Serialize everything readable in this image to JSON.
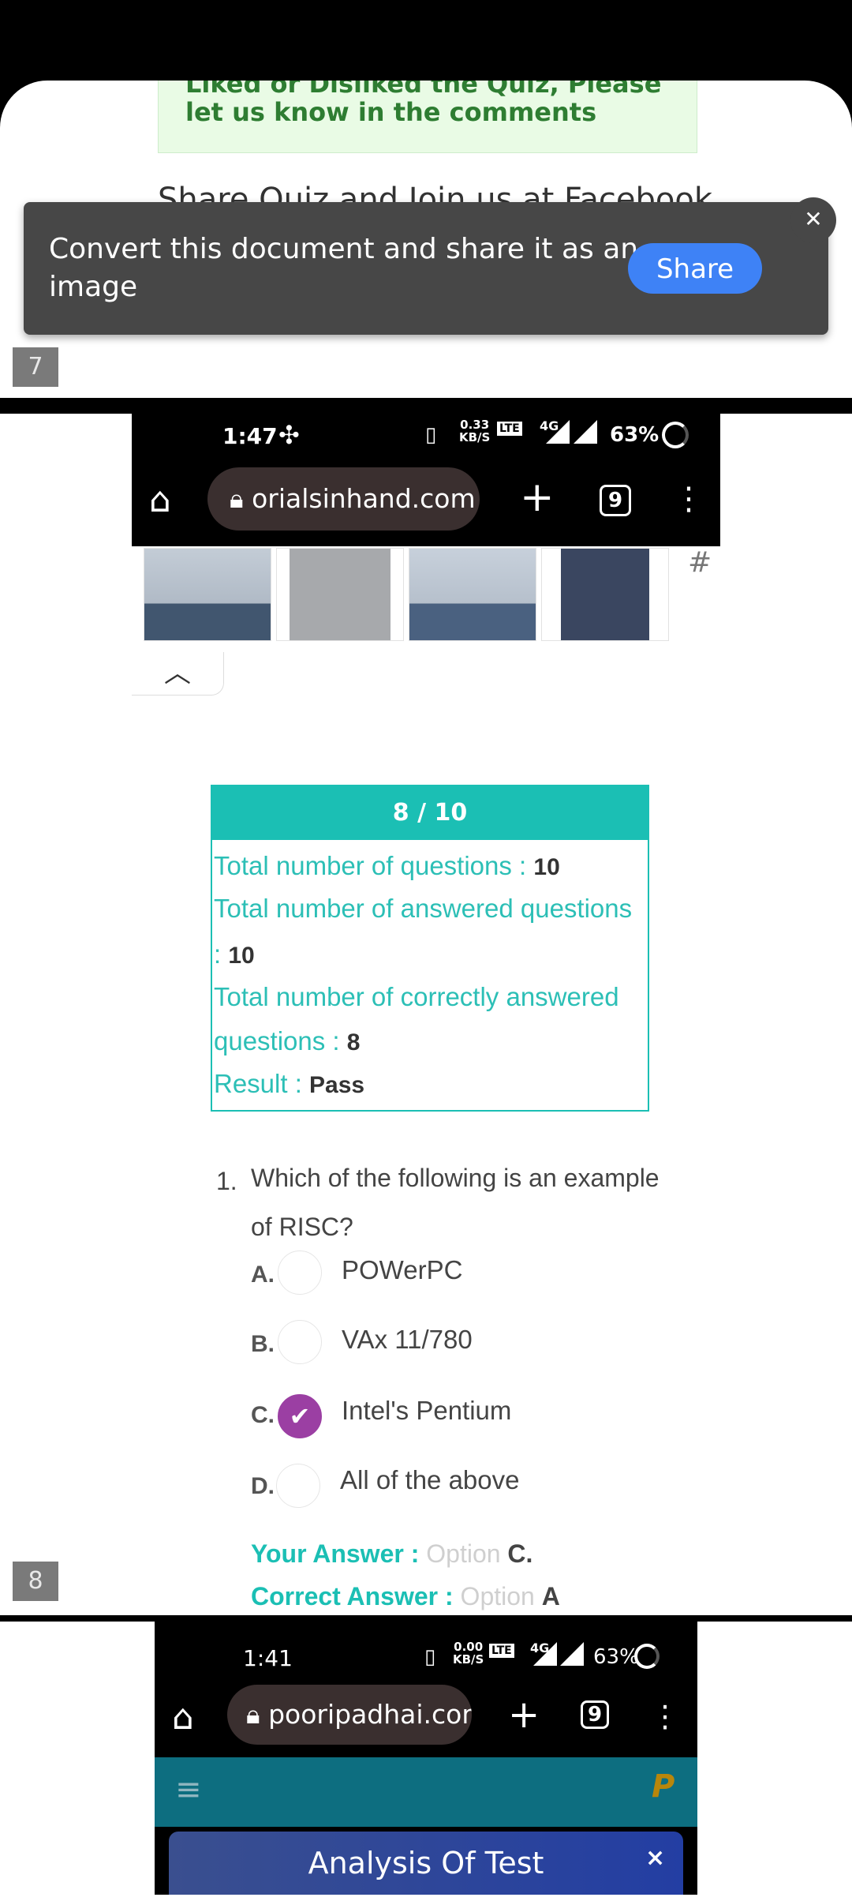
{
  "top_document": {
    "comment_text": "Liked or Disliked the Quiz, Please let us know in the comments",
    "share_heading": "Share Quiz and Join us at Facebook",
    "page_number": "7"
  },
  "toast": {
    "message": "Convert this document and share it as an image",
    "share_label": "Share",
    "close_glyph": "✕"
  },
  "screenshot_2": {
    "status": {
      "time": "1:47",
      "speed_value": "0.33",
      "speed_unit": "KB/S",
      "battery": "63%",
      "network": "4G"
    },
    "browser": {
      "url": "orialsinhand.com",
      "tab_count": "9"
    },
    "product_thumbs": [
      "shirt-grey",
      "sweater-grey",
      "shirt-blue",
      "shirt-plaid"
    ],
    "collapse_glyph": "︿",
    "result_card": {
      "score": "8 / 10",
      "total_q_label": "Total number of questions : ",
      "total_q_value": "10",
      "answered_label_1": "Total number of answered questions",
      "answered_label_2": ": ",
      "answered_value": "10",
      "correct_label_1": "Total number of correctly answered",
      "correct_label_2": "questions : ",
      "correct_value": "8",
      "result_label": "Result : ",
      "result_value": "Pass"
    },
    "question": {
      "number": "1.",
      "text_line1": "Which of the following is an example",
      "text_line2": "of RISC?",
      "options": [
        {
          "letter": "A.",
          "text": "POWerPC",
          "checked": false
        },
        {
          "letter": "B.",
          "text": "VAx 11/780",
          "checked": false
        },
        {
          "letter": "C.",
          "text": "Intel's Pentium",
          "checked": true
        },
        {
          "letter": "D.",
          "text": "All of the above",
          "checked": false
        }
      ],
      "your_answer_label": "Your Answer : ",
      "your_answer_prefix": "Option ",
      "your_answer_value": "C.",
      "correct_answer_label": "Correct Answer : ",
      "correct_answer_prefix": "Option ",
      "correct_answer_value": "A"
    },
    "page_number": "8"
  },
  "screenshot_3": {
    "status": {
      "time": "1:41",
      "speed_value": "0.00",
      "speed_unit": "KB/S",
      "battery": "63%",
      "network": "4G"
    },
    "browser": {
      "url": "pooripadhai.com",
      "tab_count": "9"
    },
    "menu_glyph": "≡",
    "logo_letter": "P",
    "analysis_title": "Analysis Of Test",
    "analysis_close": "×"
  },
  "colors": {
    "teal": "#1bbfb4",
    "checked_purple": "#9b3fa3",
    "share_blue": "#3e82f6",
    "toast_bg": "#474747"
  }
}
